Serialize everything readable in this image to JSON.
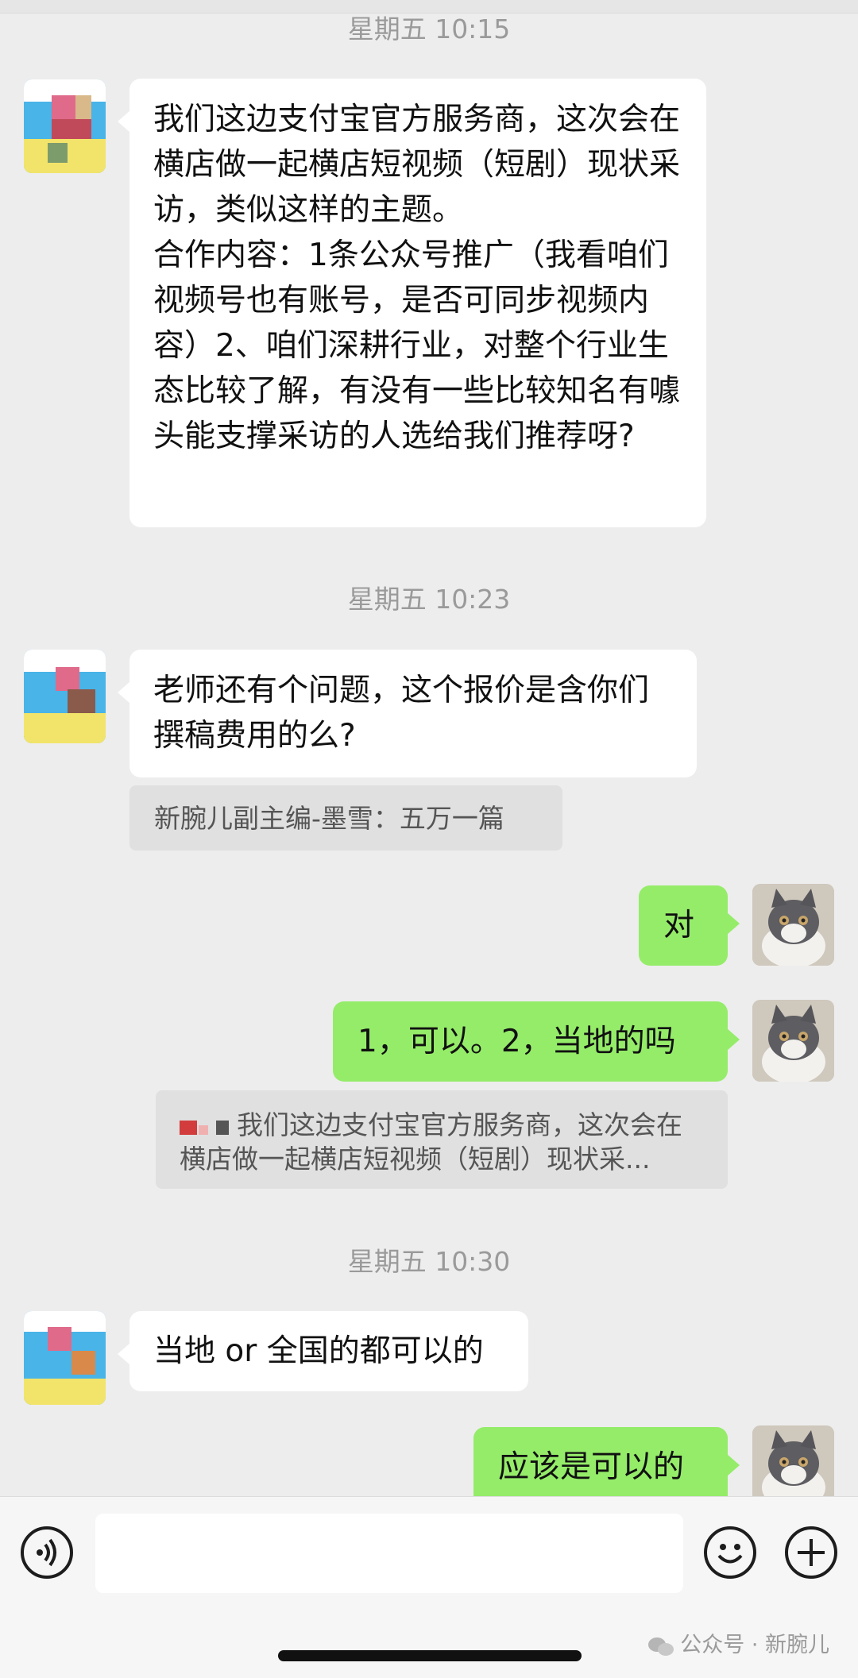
{
  "messages": {
    "time1": "星期五 10:15",
    "msg1": "我们这边支付宝官方服务商，这次会在横店做一起横店短视频（短剧）现状采访，类似这样的主题。\n合作内容：1条公众号推广（我看咱们视频号也有账号，是否可同步视频内容）2、咱们深耕行业，对整个行业生态比较了解，有没有一些比较知名有噱头能支撑采访的人选给我们推荐呀?",
    "time2": "星期五 10:23",
    "msg2": "老师还有个问题，这个报价是含你们撰稿费用的么?",
    "quote1": "新腕儿副主编-墨雪：五万一篇",
    "msg3": "对",
    "msg4": "1，可以。2，当地的吗",
    "quote2": "我们这边支付宝官方服务商，这次会在横店做一起横店短视频（短剧）现状采...",
    "time3": "星期五 10:30",
    "msg5": "当地 or 全国的都可以的",
    "msg6": "应该是可以的"
  },
  "input": {
    "value": "",
    "placeholder": ""
  },
  "icons": {
    "voice": "voice-icon",
    "emoji": "emoji-icon",
    "plus": "plus-icon"
  },
  "watermark": "公众号 · 新腕儿",
  "colors": {
    "background": "#ededed",
    "green_bubble": "#95ec69",
    "white_bubble": "#ffffff"
  }
}
